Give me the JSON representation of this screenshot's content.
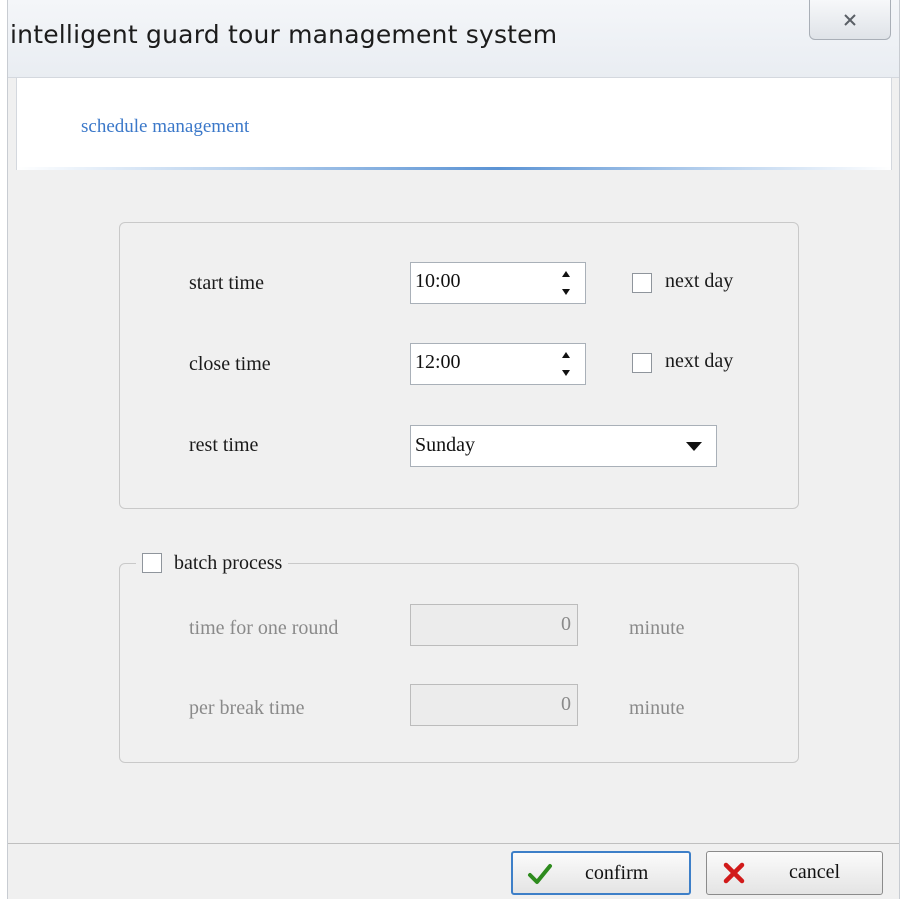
{
  "window": {
    "title": "intelligent guard tour management system"
  },
  "header": {
    "title": "schedule management"
  },
  "schedule": {
    "start_time": {
      "label": "start time",
      "value": "10:00",
      "next_day_label": "next day",
      "next_day_checked": false
    },
    "close_time": {
      "label": "close time",
      "value": "12:00",
      "next_day_label": "next day",
      "next_day_checked": false
    },
    "rest_time": {
      "label": "rest time",
      "selected": "Sunday"
    }
  },
  "batch": {
    "label": "batch process",
    "checked": false,
    "round": {
      "label": "time for one round",
      "value": "0",
      "unit": "minute"
    },
    "break": {
      "label": "per break time",
      "value": "0",
      "unit": "minute"
    }
  },
  "buttons": {
    "confirm_label": "confirm",
    "cancel_label": "cancel"
  },
  "icons": {
    "close": "close-icon",
    "confirm": "checkmark-icon",
    "cancel": "x-icon"
  },
  "colors": {
    "header_title": "#3b78c9",
    "confirm_icon": "#2e8b1e",
    "cancel_icon": "#d11a1a",
    "primary_button_border": "#3d7fc8"
  }
}
